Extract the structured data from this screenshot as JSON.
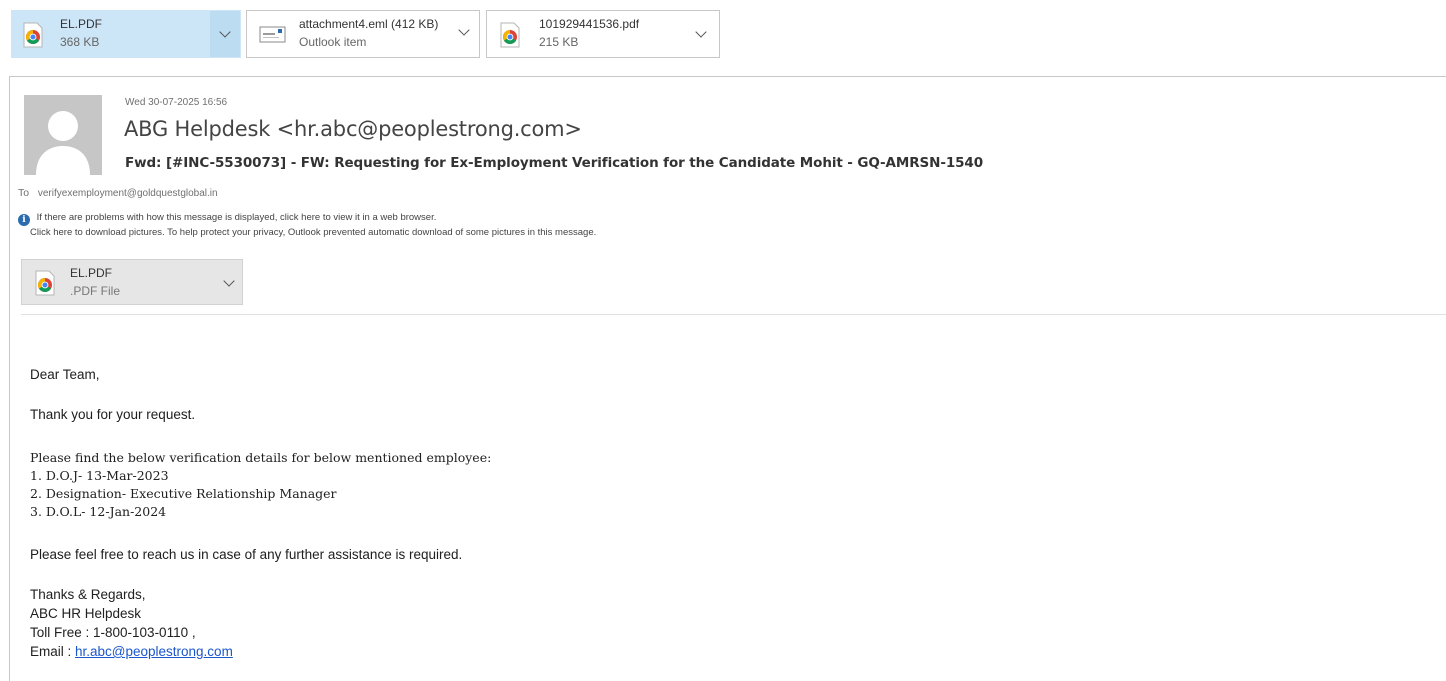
{
  "attachments_bar": [
    {
      "name": "EL.PDF",
      "size": "368 KB",
      "icon": "chrome-pdf-icon",
      "selected": true
    },
    {
      "name": "attachment4.eml (412 KB)",
      "size": "Outlook item",
      "icon": "outlook-item-icon",
      "selected": false
    },
    {
      "name": "101929441536.pdf",
      "size": "215 KB",
      "icon": "chrome-pdf-icon",
      "selected": false
    }
  ],
  "message": {
    "date": "Wed 30-07-2025 16:56",
    "sender": "ABG Helpdesk <hr.abc@peoplestrong.com>",
    "subject": "Fwd: [#INC-5530073] - FW: Requesting for Ex-Employment Verification for the Candidate Mohit - GQ-AMRSN-1540",
    "to_label": "To",
    "to_address": "verifyexemployment@goldquestglobal.in",
    "info_line1": "If there are problems with how this message is displayed, click here to view it in a web browser.",
    "info_line2": "Click here to download pictures. To help protect your privacy, Outlook prevented automatic download of some pictures in this message.",
    "inline_attachment": {
      "name": "EL.PDF",
      "type": ".PDF File"
    }
  },
  "body": {
    "greeting": "Dear Team,",
    "thanks": "Thank you for your request.",
    "intro": "Please find the below verification details for below mentioned employee:",
    "items": [
      "1. D.O.J- 13-Mar-2023",
      "2. Designation- Executive Relationship Manager",
      "3. D.O.L- 12-Jan-2024"
    ],
    "closing": "Please feel free to reach us in case of any further assistance is required.",
    "signature": {
      "regards": "Thanks & Regards,",
      "team": "ABC HR Helpdesk",
      "toll_free": "Toll Free : 1-800-103-0110 ,",
      "email_label": "Email : ",
      "email_link": "hr.abc@peoplestrong.com"
    }
  },
  "colors": {
    "selected_attachment": "#cde6f7",
    "link": "#1a56cc",
    "info_icon": "#2b6cb0"
  }
}
